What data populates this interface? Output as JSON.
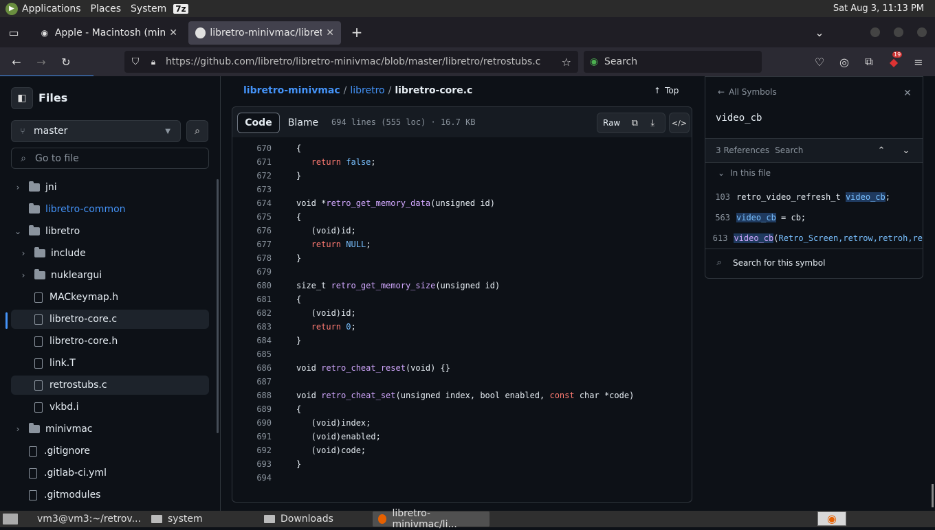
{
  "os_top": {
    "applications": "Applications",
    "places": "Places",
    "system": "System",
    "badge": "7z",
    "clock": "Sat Aug  3, 11:13 PM"
  },
  "tabs": [
    {
      "title": "Apple - Macintosh (minivmac)",
      "close": "✕"
    },
    {
      "title": "libretro-minivmac/libretro/libretro-core.c",
      "close": "✕"
    }
  ],
  "tab_new": "+",
  "nav": {
    "url": "https://github.com/libretro/libretro-minivmac/blob/master/libretro/retrostubs.c",
    "search_placeholder": "Search",
    "ext_badge": "19"
  },
  "sidebar": {
    "title": "Files",
    "branch": "master",
    "go_to_file": "Go to file",
    "items": [
      {
        "label": "jni",
        "type": "folder",
        "chev": "›"
      },
      {
        "label": "libretro-common",
        "type": "folder-link",
        "chev": ""
      },
      {
        "label": "libretro",
        "type": "folder",
        "chev": "⌄"
      },
      {
        "label": "include",
        "type": "folder",
        "chev": "›"
      },
      {
        "label": "nukleargui",
        "type": "folder",
        "chev": "›"
      },
      {
        "label": "MACkeymap.h",
        "type": "file",
        "chev": ""
      },
      {
        "label": "libretro-core.c",
        "type": "file",
        "chev": ""
      },
      {
        "label": "libretro-core.h",
        "type": "file",
        "chev": ""
      },
      {
        "label": "link.T",
        "type": "file",
        "chev": ""
      },
      {
        "label": "retrostubs.c",
        "type": "file",
        "chev": ""
      },
      {
        "label": "vkbd.i",
        "type": "file",
        "chev": ""
      },
      {
        "label": "minivmac",
        "type": "folder",
        "chev": "›"
      },
      {
        "label": ".gitignore",
        "type": "file",
        "chev": ""
      },
      {
        "label": ".gitlab-ci.yml",
        "type": "file",
        "chev": ""
      },
      {
        "label": ".gitmodules",
        "type": "file",
        "chev": ""
      }
    ]
  },
  "breadcrumb": {
    "repo": "libretro-minivmac",
    "sep1": "/",
    "dir": "libretro",
    "sep2": "/",
    "file": "libretro-core.c",
    "top": "Top"
  },
  "file_header": {
    "code_tab": "Code",
    "blame_tab": "Blame",
    "meta": "694 lines (555 loc) · 16.7 KB",
    "raw": "Raw"
  },
  "code_lines": [
    {
      "n": "670",
      "html": "{"
    },
    {
      "n": "671",
      "html": "   <span class=\"kw\">return</span> <span class=\"cn\">false</span>;"
    },
    {
      "n": "672",
      "html": "}"
    },
    {
      "n": "673",
      "html": ""
    },
    {
      "n": "674",
      "html": "void *<span class=\"fn\">retro_get_memory_data</span>(unsigned id)"
    },
    {
      "n": "675",
      "html": "{"
    },
    {
      "n": "676",
      "html": "   (void)id;"
    },
    {
      "n": "677",
      "html": "   <span class=\"kw\">return</span> <span class=\"cn\">NULL</span>;"
    },
    {
      "n": "678",
      "html": "}"
    },
    {
      "n": "679",
      "html": ""
    },
    {
      "n": "680",
      "html": "size_t <span class=\"fn\">retro_get_memory_size</span>(unsigned id)"
    },
    {
      "n": "681",
      "html": "{"
    },
    {
      "n": "682",
      "html": "   (void)id;"
    },
    {
      "n": "683",
      "html": "   <span class=\"kw\">return</span> <span class=\"cn\">0</span>;"
    },
    {
      "n": "684",
      "html": "}"
    },
    {
      "n": "685",
      "html": ""
    },
    {
      "n": "686",
      "html": "void <span class=\"fn\">retro_cheat_reset</span>(void) {}"
    },
    {
      "n": "687",
      "html": ""
    },
    {
      "n": "688",
      "html": "void <span class=\"fn\">retro_cheat_set</span>(unsigned index, bool enabled, <span class=\"kw\">const</span> char *code)"
    },
    {
      "n": "689",
      "html": "{"
    },
    {
      "n": "690",
      "html": "   (void)index;"
    },
    {
      "n": "691",
      "html": "   (void)enabled;"
    },
    {
      "n": "692",
      "html": "   (void)code;"
    },
    {
      "n": "693",
      "html": "}"
    },
    {
      "n": "694",
      "html": ""
    }
  ],
  "symbols": {
    "back": "All Symbols",
    "name": "video_cb",
    "refs": "3 References",
    "search_tab": "Search",
    "in_file": "In this file",
    "results": [
      {
        "line": "103",
        "html": "retro_video_refresh_t <span class=\"cn\" style=\"background:#1f3a5f\">video_cb</span>;"
      },
      {
        "line": "563",
        "html": "<span class=\"cn\" style=\"background:#1f3a5f\">video_cb</span> = cb;"
      },
      {
        "line": "613",
        "html": "<span class=\"fn\" style=\"background:#1f3a5f\">video_cb</span>(<span class=\"cn\">Retro_Screen,retrow,retroh,re</span>"
      }
    ],
    "search_symbol": "Search for this symbol"
  },
  "taskbar": [
    {
      "label": "vm3@vm3:~/retrov...",
      "active": false
    },
    {
      "label": "system",
      "active": false
    },
    {
      "label": "Downloads",
      "active": false
    },
    {
      "label": "libretro-minivmac/li...",
      "active": true
    }
  ],
  "colors": {
    "accent": "#4493f8",
    "link": "#4493f8",
    "bg": "#0d1117",
    "border": "#30363d"
  }
}
